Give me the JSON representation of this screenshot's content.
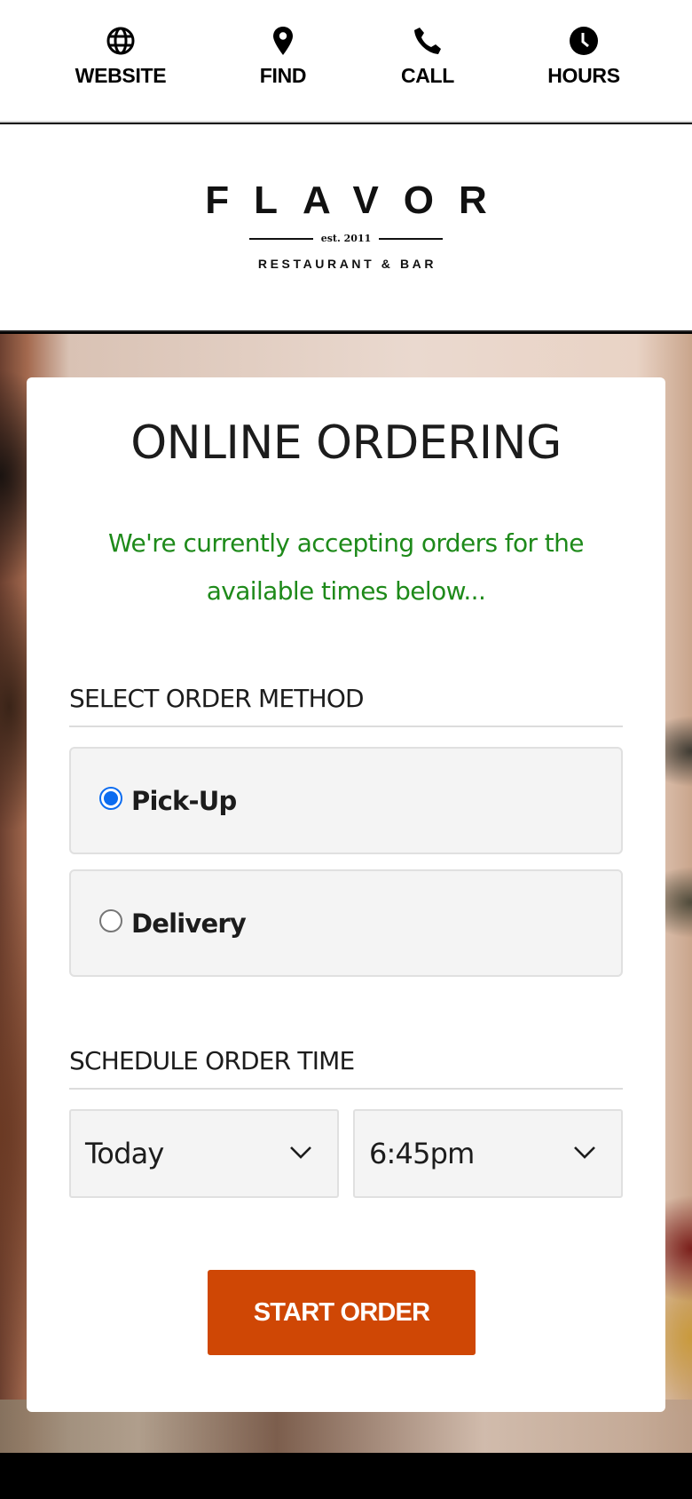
{
  "topnav": {
    "items": [
      {
        "label": "WEBSITE",
        "icon": "globe-icon"
      },
      {
        "label": "FIND",
        "icon": "map-pin-icon"
      },
      {
        "label": "CALL",
        "icon": "phone-icon"
      },
      {
        "label": "HOURS",
        "icon": "clock-icon"
      }
    ]
  },
  "logo": {
    "name": "FLAVOR",
    "established": "est. 2011",
    "tagline": "RESTAURANT & BAR"
  },
  "ordering": {
    "title": "ONLINE ORDERING",
    "notice": "We're currently accepting orders for the available times below...",
    "notice_color": "#1e8a1a",
    "method_section": {
      "label": "SELECT ORDER METHOD",
      "options": [
        {
          "label": "Pick-Up",
          "selected": true
        },
        {
          "label": "Delivery",
          "selected": false
        }
      ]
    },
    "time_section": {
      "label": "SCHEDULE ORDER TIME",
      "day_select": {
        "value": "Today"
      },
      "time_select": {
        "value": "6:45pm"
      }
    },
    "start_button": {
      "label": "START ORDER",
      "color": "#cf4705"
    }
  },
  "colors": {
    "radio_accent": "#0b6cf0"
  }
}
